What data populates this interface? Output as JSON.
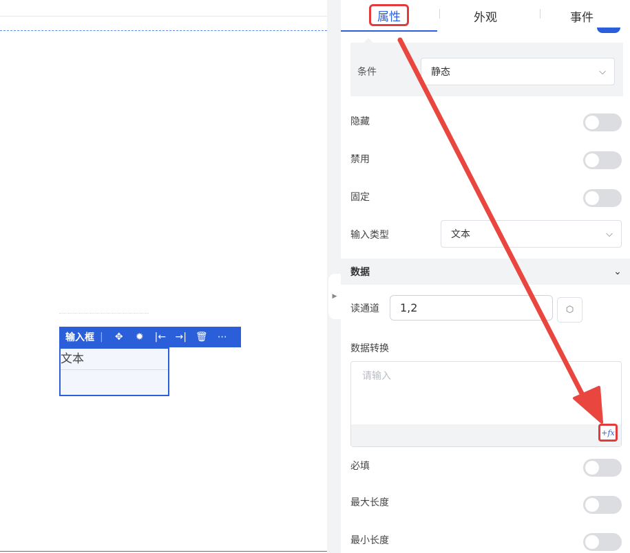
{
  "canvas": {
    "collapse_icon": "▶",
    "component": {
      "name": "输入框",
      "separator": "|",
      "tool_icons": [
        "move-icon",
        "debug-icon",
        "move-left-icon",
        "move-right-icon",
        "delete-icon",
        "more-icon"
      ],
      "tool_glyphs": [
        "✥",
        "✹",
        "|←",
        "→|",
        "🗑",
        "⋯"
      ],
      "text": "文本"
    }
  },
  "panel": {
    "tabs": [
      {
        "label": "属性",
        "active": true
      },
      {
        "label": "外观",
        "active": false
      },
      {
        "label": "事件",
        "active": false
      }
    ],
    "condition": {
      "label": "条件",
      "value": "静态"
    },
    "rows": [
      {
        "label": "隐藏",
        "on": false
      },
      {
        "label": "禁用",
        "on": false
      },
      {
        "label": "固定",
        "on": false
      }
    ],
    "input_type": {
      "label": "输入类型",
      "value": "文本"
    },
    "data_section": {
      "title": "数据",
      "read_channel": {
        "label": "读通道",
        "value": "1,2"
      },
      "transform": {
        "label": "数据转换",
        "placeholder": "请输入",
        "fx_label": "+fx"
      }
    },
    "validation_rows": [
      {
        "label": "必填",
        "on": false
      },
      {
        "label": "最大长度",
        "on": false
      },
      {
        "label": "最小长度",
        "on": false
      }
    ]
  },
  "colors": {
    "accent": "#2b5fd9",
    "annotation": "#e33b3b",
    "toggle_off": "#dcdde0"
  }
}
